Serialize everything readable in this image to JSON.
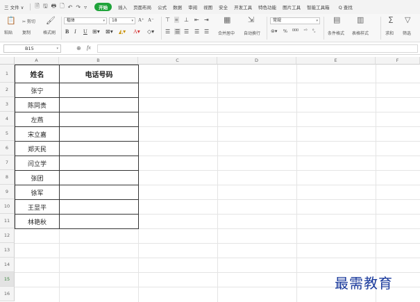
{
  "menubar": {
    "file_label": "三 文件 ∨",
    "quick_icons": [
      "🗎",
      "🖫",
      "🖶",
      "🗋",
      "↶",
      "↷",
      "▿"
    ],
    "tabs": [
      "开始",
      "插入",
      "页面布局",
      "公式",
      "数据",
      "审阅",
      "视图",
      "安全",
      "开发工具",
      "特色功能",
      "图片工具",
      "智能工具箱"
    ],
    "search_label": "Q 查找"
  },
  "ribbon": {
    "paste_label": "粘贴",
    "cut_label": "✂ 剪切",
    "copy_label": "复制",
    "format_painter_label": "格式刷",
    "font_name": "楷体",
    "font_size": "18",
    "grow_font": "A⁺",
    "shrink_font": "A⁻",
    "bold": "B",
    "italic": "I",
    "underline": "U",
    "merge_center_label": "合并居中",
    "wrap_text_label": "自动换行",
    "number_format": "常规",
    "conditional_format_label": "条件格式",
    "table_style_label": "表格样式",
    "sum_label": "求和",
    "filter_label": "筛选"
  },
  "formula_bar": {
    "cell_ref": "B15",
    "fx_label": "fx"
  },
  "columns": [
    "A",
    "B",
    "C",
    "D",
    "E",
    "F"
  ],
  "rows": [
    "1",
    "2",
    "3",
    "4",
    "5",
    "6",
    "7",
    "8",
    "9",
    "10",
    "11",
    "12",
    "13",
    "14",
    "15",
    "16"
  ],
  "table": {
    "header_name": "姓名",
    "header_phone": "电话号码",
    "names": [
      "张宁",
      "陈同贵",
      "左燕",
      "宋立嘉",
      "郑天民",
      "闫立学",
      "张团",
      "徐军",
      "王显平",
      "林艳秋"
    ]
  },
  "watermark": "最需教育"
}
